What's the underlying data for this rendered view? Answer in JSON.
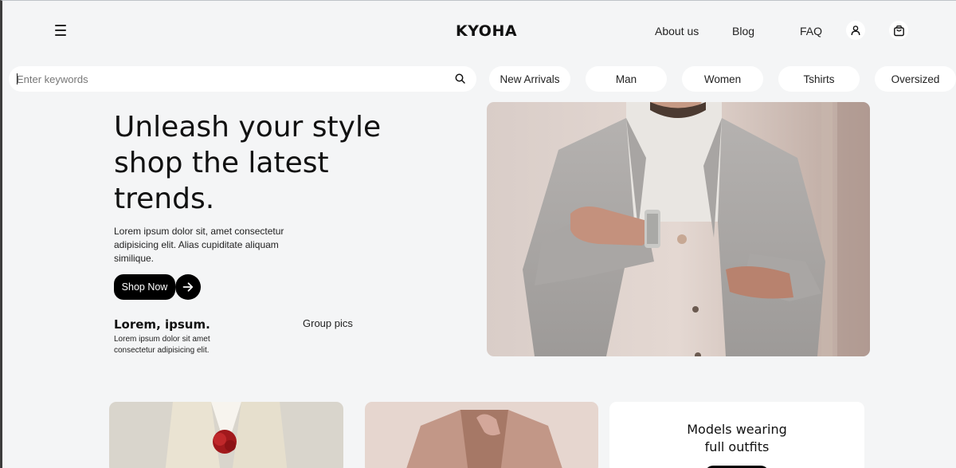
{
  "header": {
    "logo": "KYOHA",
    "nav": [
      "About us",
      "Blog",
      "FAQ"
    ]
  },
  "search": {
    "placeholder": "Enter keywords"
  },
  "categories": [
    "New Arrivals",
    "Man",
    "Women",
    "Tshirts",
    "Oversized"
  ],
  "hero": {
    "title_lines": [
      "Unleash your style",
      "shop the latest",
      "trends."
    ],
    "description": "Lorem ipsum dolor sit, amet consectetur adipisicing elit. Alias cupiditate aliquam similique.",
    "cta_label": "Shop Now",
    "stat_title": "Lorem, ipsum.",
    "stat_desc": "Lorem ipsum dolor sit amet consectetur adipisicing elit.",
    "group_pics_label": "Group pics"
  },
  "cards": {
    "models_title_lines": [
      "Models wearing",
      "full outfits"
    ]
  },
  "colors": {
    "background": "#f4f5f6",
    "surface": "#ffffff",
    "accent": "#000000"
  }
}
